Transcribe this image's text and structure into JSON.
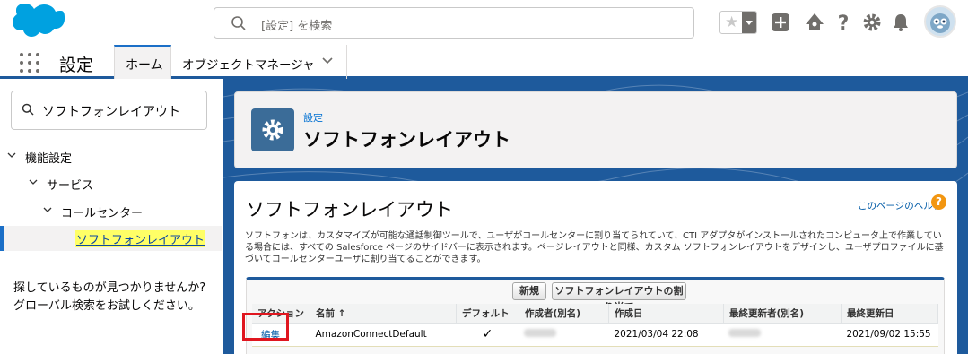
{
  "header": {
    "search_placeholder": "[設定] を検索"
  },
  "nav": {
    "app_name": "設定",
    "tabs": [
      {
        "label": "ホーム"
      },
      {
        "label": "オブジェクトマネージャ"
      }
    ]
  },
  "sidebar": {
    "search_value": "ソフトフォンレイアウト",
    "tree": [
      {
        "label": "機能設定"
      },
      {
        "label": "サービス"
      },
      {
        "label": "コールセンター"
      },
      {
        "label": "ソフトフォンレイアウト"
      }
    ],
    "not_found_text": "探しているものが見つかりませんか? グローバル検索をお試しください。"
  },
  "page_header": {
    "breadcrumb": "設定",
    "title": "ソフトフォンレイアウト"
  },
  "content": {
    "title": "ソフトフォンレイアウト",
    "help_link": "このページのヘルプ",
    "description": "ソフトフォンは、カスタマイズが可能な通話制御ツールで、ユーザがコールセンターに割り当てられていて、CTI アダプタがインストールされたコンピュータ上で作業している場合には、すべての Salesforce ページのサイドバーに表示されます。ページレイアウトと同様、カスタム ソフトフォンレイアウトをデザインし、ユーザプロファイルに基づいてコールセンターユーザに割り当てることができます。",
    "buttons": {
      "new": "新規",
      "assign": "ソフトフォンレイアウトの割り当て"
    },
    "table": {
      "columns": [
        "アクション",
        "名前 ↑",
        "デフォルト",
        "作成者(別名)",
        "作成日",
        "最終更新者(別名)",
        "最終更新日"
      ],
      "rows": [
        {
          "action": "編集",
          "name": "AmazonConnectDefault",
          "default": "✓",
          "created_by": "",
          "created_date": "2021/03/04 22:08",
          "modified_by": "",
          "modified_date": "2021/09/02 15:55"
        }
      ]
    }
  },
  "colors": {
    "brand_blue": "#1e5a9c",
    "link": "#015ba7",
    "highlight": "#ffff66",
    "annotation_red": "#e0161f"
  }
}
